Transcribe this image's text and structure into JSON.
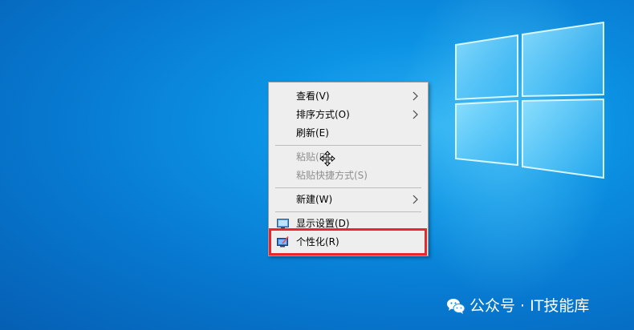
{
  "desktop": {
    "background_color": "#0a8ad9",
    "logo": "windows-logo"
  },
  "context_menu": {
    "items": [
      {
        "label": "查看(V)",
        "has_submenu": true,
        "enabled": true
      },
      {
        "label": "排序方式(O)",
        "has_submenu": true,
        "enabled": true
      },
      {
        "label": "刷新(E)",
        "has_submenu": false,
        "enabled": true
      },
      {
        "label": "粘贴(P)",
        "has_submenu": false,
        "enabled": false
      },
      {
        "label": "粘贴快捷方式(S)",
        "has_submenu": false,
        "enabled": false
      },
      {
        "label": "新建(W)",
        "has_submenu": true,
        "enabled": true
      },
      {
        "label": "显示设置(D)",
        "has_submenu": false,
        "enabled": true,
        "icon": "display-settings-icon"
      },
      {
        "label": "个性化(R)",
        "has_submenu": false,
        "enabled": true,
        "icon": "personalize-icon",
        "highlighted": true
      }
    ],
    "highlight_color": "#e8262b"
  },
  "cursor": {
    "type": "move-cursor"
  },
  "watermark": {
    "text": "公众号 · IT技能库",
    "icon": "wechat-icon"
  }
}
